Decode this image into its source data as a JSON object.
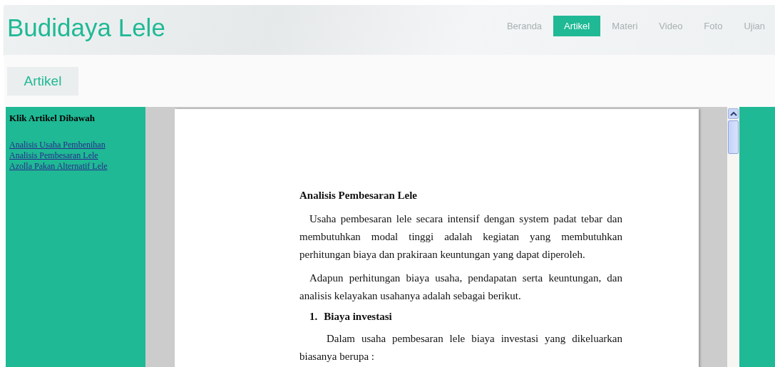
{
  "header": {
    "title": "Budidaya Lele"
  },
  "nav": [
    {
      "label": "Beranda",
      "selected": false
    },
    {
      "label": "Artikel",
      "selected": true
    },
    {
      "label": "Materi",
      "selected": false
    },
    {
      "label": "Video",
      "selected": false
    },
    {
      "label": "Foto",
      "selected": false
    },
    {
      "label": "Ujian",
      "selected": false
    }
  ],
  "page_heading": "Artikel",
  "sidebar": {
    "title": "Klik Artikel Dibawah",
    "links": [
      "Analisis Usaha Pembenihan",
      "Analisis Pembesaran Lele",
      "Azolla Pakan Alternatif Lele"
    ]
  },
  "document": {
    "blocks": [
      {
        "kind": "heading",
        "text": "Analisis Pembesaran Lele"
      },
      {
        "kind": "paragraph",
        "text": "Usaha pembesaran lele secara intensif dengan system padat tebar dan membutuhkan modal tinggi adalah kegiatan yang membutuhkan perhitungan biaya dan prakiraan keuntungan yang dapat diperoleh."
      },
      {
        "kind": "paragraph",
        "text": "Adapun perhitungan biaya usaha, pendapatan serta keuntungan, dan analisis kelayakan usahanya adalah sebagai berikut."
      },
      {
        "kind": "list_heading",
        "number": "1.",
        "text": "Biaya investasi"
      },
      {
        "kind": "list_paragraph",
        "text": "Dalam usaha pembesaran lele biaya investasi yang dikeluarkan biasanya berupa :"
      }
    ]
  }
}
